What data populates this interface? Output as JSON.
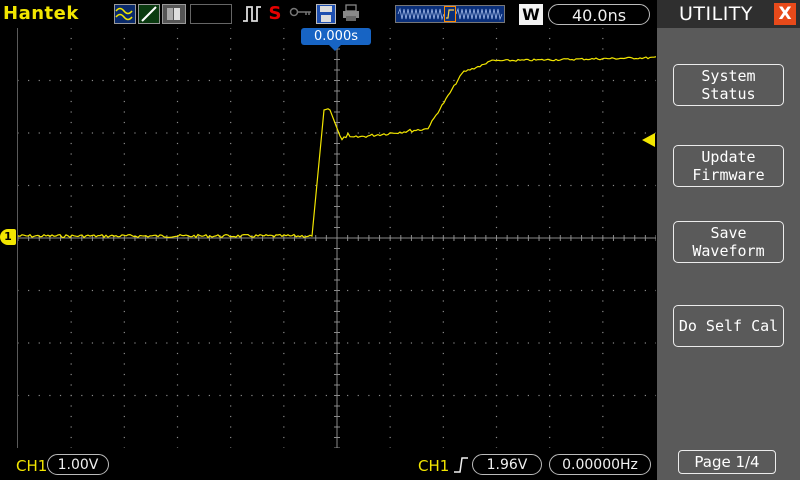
{
  "top_bar": {
    "brand": "Hantek",
    "time_div": "40.0ns",
    "acq_mode": "W",
    "icons": [
      "waveform-icon",
      "line-display-icon",
      "dots-display-icon",
      "trigger-pulse-icon",
      "stop-icon",
      "lock-icon",
      "save-disk-icon",
      "print-icon"
    ],
    "stop_symbol": "S"
  },
  "trigger_position": "0.000s",
  "channel_marker": "1",
  "bottom_bar": {
    "ch1_label": "CH1",
    "ch1_scale": "1.00V",
    "trig_source": "CH1",
    "trig_level": "1.96V",
    "frequency": "0.00000Hz"
  },
  "side_panel": {
    "title": "UTILITY",
    "close_symbol": "X",
    "buttons": [
      {
        "label": "System\nStatus"
      },
      {
        "label": "Update\nFirmware"
      },
      {
        "label": "Save\nWaveform"
      },
      {
        "label": "Do Self Cal"
      }
    ],
    "page": "Page 1/4"
  },
  "colors": {
    "trace": "#f2e600",
    "grid": "#8a8a8a",
    "accent": "#1764c4",
    "close": "#e84a1a"
  }
}
